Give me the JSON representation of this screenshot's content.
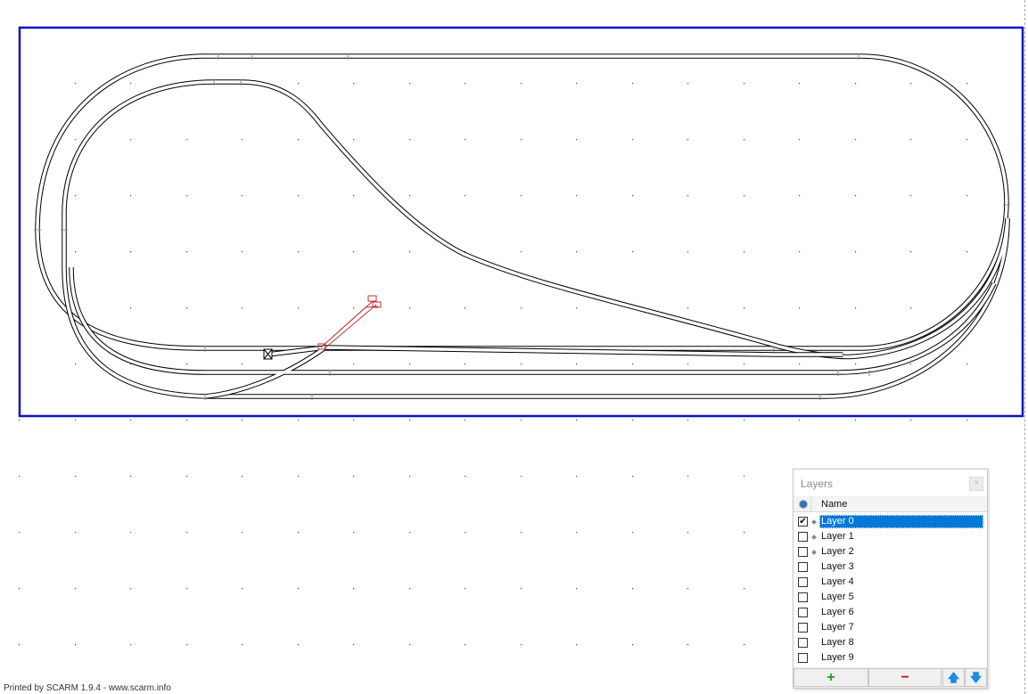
{
  "colors": {
    "border": "#1010c8",
    "track": "#000000",
    "turnout": "#c03030",
    "selection": "#0078d7",
    "add": "#18a518",
    "remove": "#d01010",
    "arrows": "#1a8ae6"
  },
  "footer": "Printed by SCARM 1.9.4 - www.scarm.info",
  "layers_panel": {
    "title": "Layers",
    "column_name": "Name",
    "rows": [
      {
        "name": "Layer 0",
        "checked": true,
        "selected": true,
        "has_content": true
      },
      {
        "name": "Layer 1",
        "checked": false,
        "selected": false,
        "has_content": true
      },
      {
        "name": "Layer 2",
        "checked": false,
        "selected": false,
        "has_content": true
      },
      {
        "name": "Layer 3",
        "checked": false,
        "selected": false,
        "has_content": false
      },
      {
        "name": "Layer 4",
        "checked": false,
        "selected": false,
        "has_content": false
      },
      {
        "name": "Layer 5",
        "checked": false,
        "selected": false,
        "has_content": false
      },
      {
        "name": "Layer 6",
        "checked": false,
        "selected": false,
        "has_content": false
      },
      {
        "name": "Layer 7",
        "checked": false,
        "selected": false,
        "has_content": false
      },
      {
        "name": "Layer 8",
        "checked": false,
        "selected": false,
        "has_content": false
      },
      {
        "name": "Layer 9",
        "checked": false,
        "selected": false,
        "has_content": false
      }
    ],
    "buttons": {
      "add": "+",
      "remove": "−",
      "up": "🡅",
      "down": "🡇"
    },
    "icons": {
      "visibility": "eye-icon",
      "close": "close-icon"
    }
  }
}
